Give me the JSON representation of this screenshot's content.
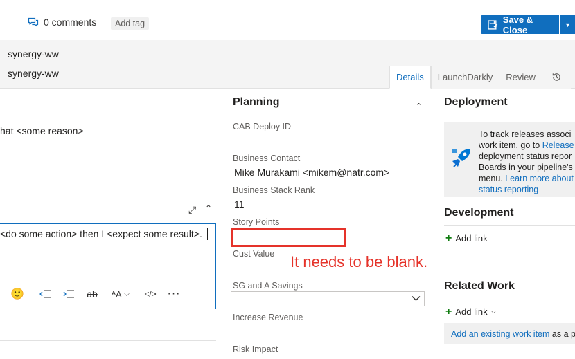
{
  "header": {
    "comments_count": "0 comments",
    "add_tag": "Add tag",
    "save_close": "Save & Close",
    "area_path": "synergy-ww",
    "iteration_path": "synergy-ww"
  },
  "tabs": [
    {
      "label": "Details",
      "active": true
    },
    {
      "label": "LaunchDarkly",
      "active": false
    },
    {
      "label": "Review",
      "active": false
    }
  ],
  "left": {
    "description_text": "hat <some reason>",
    "acceptance_text": "<do some action> then I <expect some result>."
  },
  "planning": {
    "title": "Planning",
    "fields": {
      "cab_deploy_id": {
        "label": "CAB Deploy ID",
        "value": ""
      },
      "business_contact": {
        "label": "Business Contact",
        "value": "Mike Murakami <mikem@natr.com>"
      },
      "business_stack_rank": {
        "label": "Business Stack Rank",
        "value": "11"
      },
      "story_points": {
        "label": "Story Points",
        "value": ""
      },
      "cust_value": {
        "label": "Cust Value",
        "value": ""
      },
      "sg_a_savings": {
        "label": "SG and A Savings",
        "value": ""
      },
      "increase_revenue": {
        "label": "Increase Revenue",
        "value": ""
      },
      "risk_impact": {
        "label": "Risk Impact",
        "value": ""
      }
    }
  },
  "annotation": {
    "note": "It needs to be blank.",
    "color": "#e5332a"
  },
  "deployment": {
    "title": "Deployment",
    "line1": "To track releases associ",
    "line2_prefix": "work item, go to ",
    "line2_link": "Release",
    "line3": "deployment status repor",
    "line4": "Boards in your pipeline's",
    "line5_prefix": "menu. ",
    "line5_link": "Learn more about",
    "line6_link": "status reporting"
  },
  "development": {
    "title": "Development",
    "add_link": "Add link"
  },
  "related_work": {
    "title": "Related Work",
    "add_link": "Add link",
    "existing_link": "Add an existing work item",
    "existing_suffix": " as a p"
  },
  "colors": {
    "accent": "#106ebe",
    "add_green": "#107c10"
  }
}
